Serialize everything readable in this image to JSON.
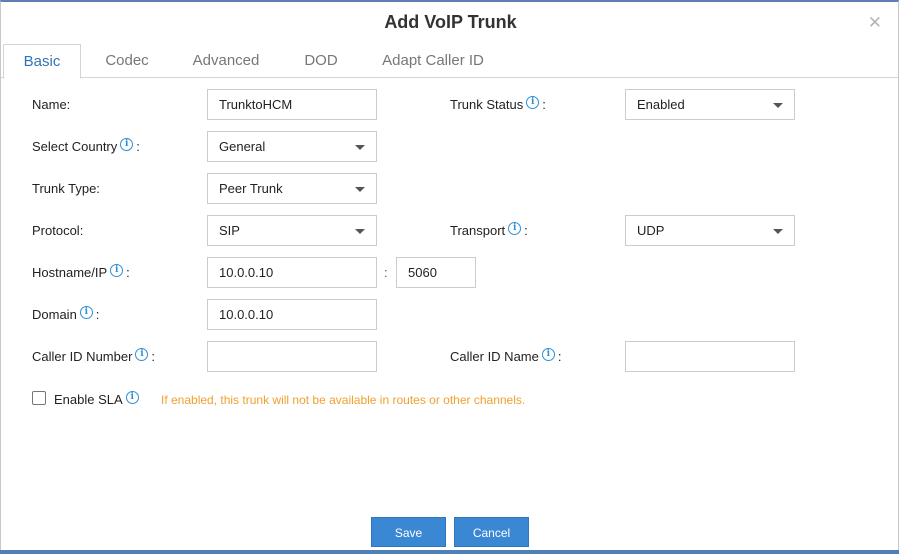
{
  "dialog": {
    "title": "Add VoIP Trunk"
  },
  "tabs": [
    {
      "label": "Basic"
    },
    {
      "label": "Codec"
    },
    {
      "label": "Advanced"
    },
    {
      "label": "DOD"
    },
    {
      "label": "Adapt Caller ID"
    }
  ],
  "form": {
    "name": {
      "label": "Name:",
      "value": "TrunktoHCM"
    },
    "trunk_status": {
      "label": "Trunk Status",
      "colon": ":",
      "value": "Enabled"
    },
    "select_country": {
      "label": "Select Country",
      "colon": ":",
      "value": "General"
    },
    "trunk_type": {
      "label": "Trunk Type:",
      "value": "Peer Trunk"
    },
    "protocol": {
      "label": "Protocol:",
      "value": "SIP"
    },
    "transport": {
      "label": "Transport",
      "colon": ":",
      "value": "UDP"
    },
    "hostname": {
      "label": "Hostname/IP",
      "colon": ":",
      "value": "10.0.0.10",
      "separator": ":",
      "port": "5060"
    },
    "domain": {
      "label": "Domain",
      "colon": ":",
      "value": "10.0.0.10"
    },
    "caller_id_number": {
      "label": "Caller ID Number",
      "colon": ":",
      "value": ""
    },
    "caller_id_name": {
      "label": "Caller ID Name",
      "colon": ":",
      "value": ""
    },
    "enable_sla": {
      "label": "Enable SLA",
      "checked": false,
      "warning": "If enabled, this trunk will not be available in routes or other channels."
    }
  },
  "buttons": {
    "save": "Save",
    "cancel": "Cancel"
  },
  "icons": {
    "info": "info-icon",
    "close": "close-icon",
    "caret": "chevron-down-icon",
    "info_glyph": "i",
    "close_glyph": "✕"
  },
  "colors": {
    "accent": "#2e75b6",
    "button": "#3a87d4",
    "info": "#2e8fd6",
    "warning": "#f0a030"
  }
}
